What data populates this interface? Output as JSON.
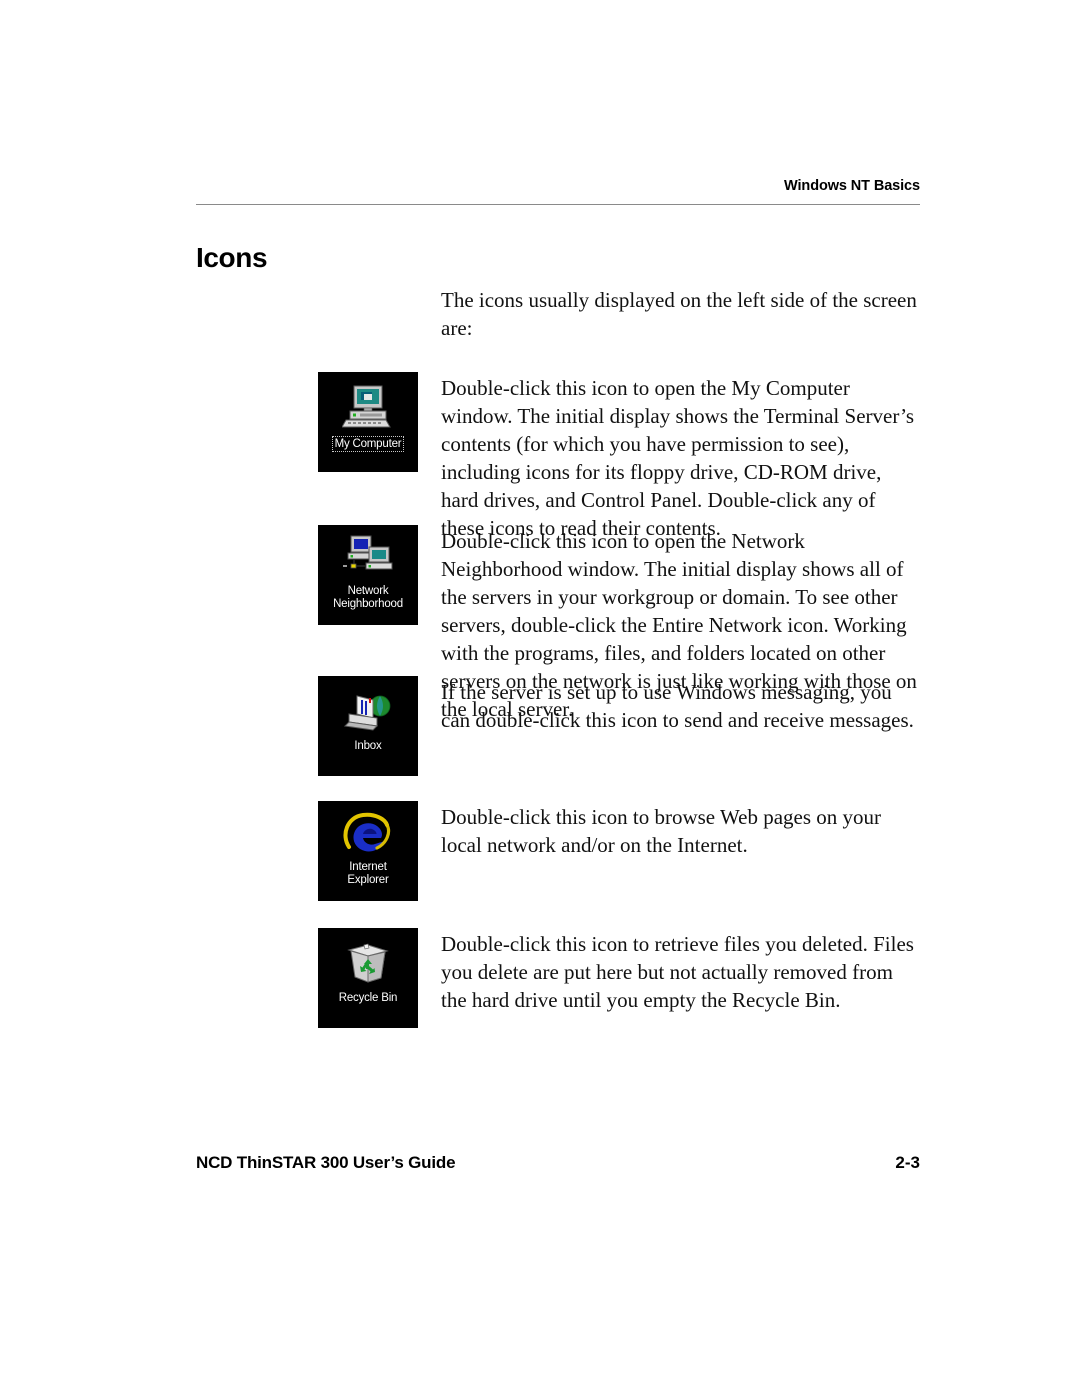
{
  "header": {
    "running_head": "Windows NT Basics"
  },
  "section": {
    "title": "Icons",
    "intro": "The icons usually displayed on the left side of the screen are:"
  },
  "entries": [
    {
      "icon_name": "my-computer-icon",
      "icon_label": "My Computer",
      "selected": true,
      "description": "Double-click this icon to open the My Computer window. The initial display shows the Terminal Server’s contents (for which you have permission to see), including icons for its floppy drive, CD-ROM drive, hard drives, and Control Panel. Double-click any of these icons to read their contents."
    },
    {
      "icon_name": "network-neighborhood-icon",
      "icon_label": "Network\nNeighborhood",
      "selected": false,
      "description": "Double-click this icon to open the Network Neighborhood window. The initial display shows all of the servers in your workgroup or domain. To see other servers, double-click the Entire Network icon. Working with the programs, files, and folders located on other servers on the network is just like working with those on the local server."
    },
    {
      "icon_name": "inbox-icon",
      "icon_label": "Inbox",
      "selected": false,
      "description": "If the server is set up to use Windows messaging, you can double-click this icon to send and receive messages."
    },
    {
      "icon_name": "internet-explorer-icon",
      "icon_label": "Internet\nExplorer",
      "selected": false,
      "description": "Double-click this icon to browse Web pages on your local network and/or on the Internet."
    },
    {
      "icon_name": "recycle-bin-icon",
      "icon_label": "Recycle Bin",
      "selected": false,
      "description": "Double-click this icon to retrieve files you deleted. Files you delete are put here but not actually removed from the hard drive until you empty the Recycle Bin."
    }
  ],
  "footer": {
    "guide_title": "NCD ThinSTAR 300 User’s Guide",
    "page_number": "2-3"
  },
  "colors": {
    "icon_background": "#000000",
    "rule": "#8a8a8a",
    "text": "#111111",
    "ie_blue": "#1a2ec7",
    "recycle_green": "#1a9a33"
  }
}
